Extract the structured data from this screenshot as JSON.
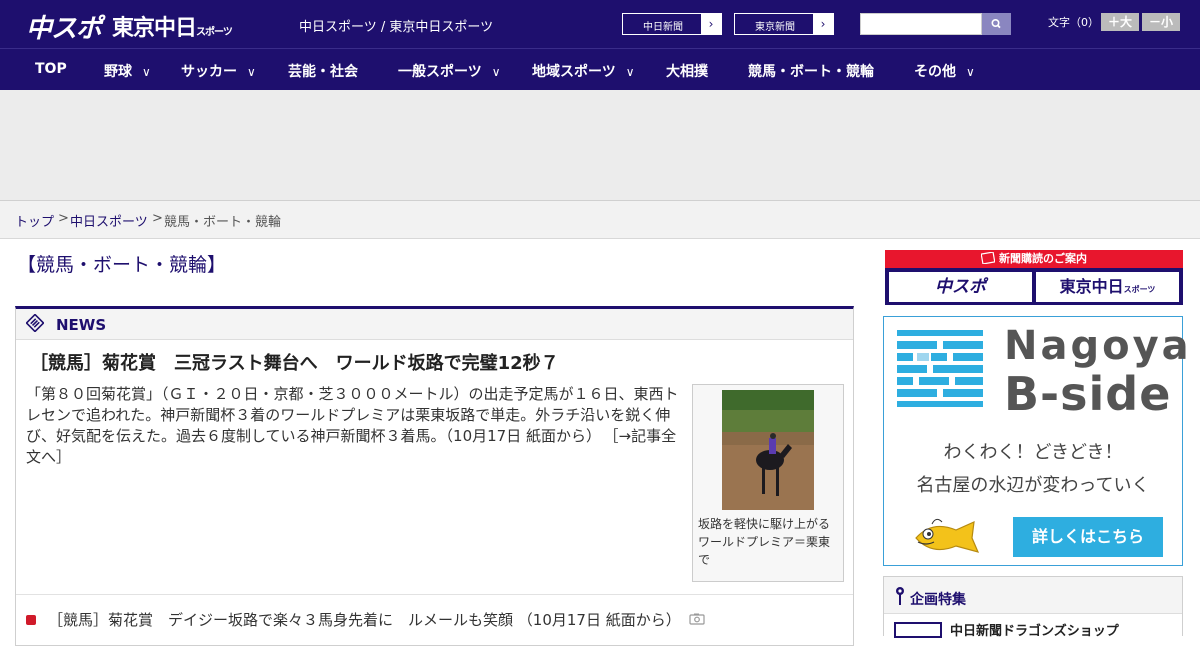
{
  "header": {
    "logo_chuspo": "中スポ",
    "logo_tokyo": "東京中日",
    "logo_tokyo_small": "スポーツ",
    "tagline": "中日スポーツ / 東京中日スポーツ",
    "site_links": [
      "中日新聞",
      "東京新聞"
    ],
    "search_placeholder": "",
    "font_size_label": "文字（0）",
    "font_bigger": "＋大",
    "font_smaller": "－小"
  },
  "nav": {
    "items": [
      {
        "label": "TOP"
      },
      {
        "label": "野球"
      },
      {
        "label": "サッカー"
      },
      {
        "label": "芸能・社会"
      },
      {
        "label": "一般スポーツ"
      },
      {
        "label": "地域スポーツ"
      },
      {
        "label": "大相撲"
      },
      {
        "label": "競馬・ボート・競輪"
      },
      {
        "label": "その他"
      }
    ]
  },
  "breadcrumb": {
    "items": [
      "トップ",
      "中日スポーツ",
      "競馬・ボート・競輪"
    ],
    "separator": ">"
  },
  "page_title": "【競馬・ボート・競輪】",
  "news": {
    "section_title": "NEWS",
    "headline": "［競馬］菊花賞　三冠ラスト舞台へ　ワールド坂路で完璧12秒７",
    "lead": "「第８０回菊花賞」（ＧＩ・２０日・京都・芝３０００メートル）の出走予定馬が１６日、東西トレセンで追われた。神戸新聞杯３着のワールドプレミアは栗東坂路で単走。外ラチ沿いを鋭く伸び、好気配を伝えた。過去６度制している神戸新聞杯３着馬。（10月17日 紙面から）",
    "read_more": "［→記事全文へ］",
    "photo_caption": "坂路を軽快に駆け上がるワールドプレミア＝栗東で",
    "sub_item": "［競馬］菊花賞　デイジー坂路で楽々３馬身先着に　ルメールも笑顔 （10月17日 紙面から）"
  },
  "sidebar": {
    "subscribe_header": "新聞購読のご案内",
    "subscribe_buttons": [
      "中スポ",
      "東京中日"
    ],
    "subscribe_small": "スポーツ",
    "bside_title1": "Nagoya",
    "bside_title2": "B-side",
    "bside_line1": "わくわく！どきどき！",
    "bside_line2": "名古屋の水辺が変わっていく",
    "bside_button": "詳しくはこちら",
    "feature_header": "企画特集",
    "feature_item": "中日新聞ドラゴンズショップ"
  },
  "colors": {
    "brand": "#1e0f6e",
    "accent_red": "#e8162d",
    "bside_blue": "#2eaee0"
  }
}
